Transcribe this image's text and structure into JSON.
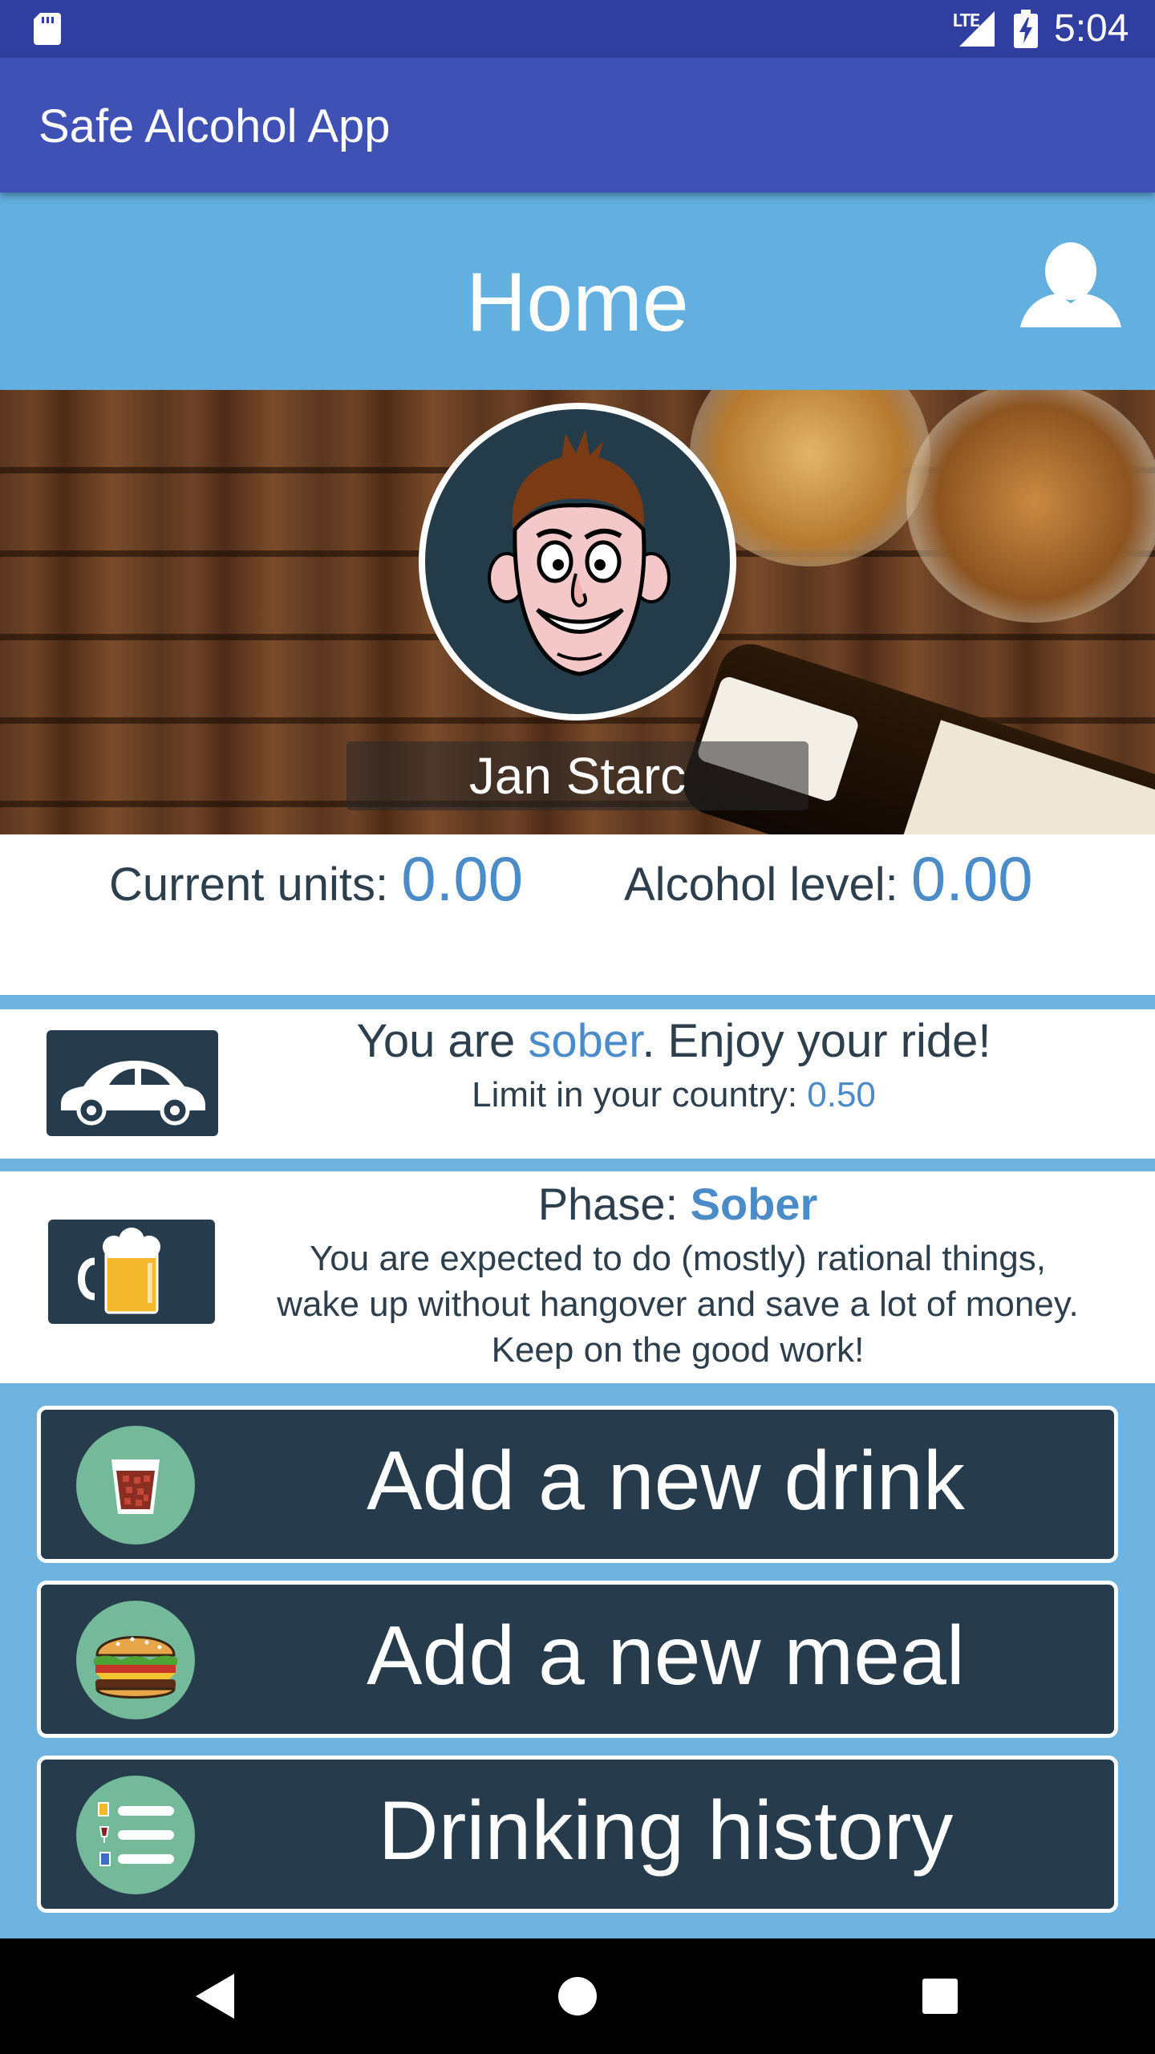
{
  "status_bar": {
    "network": "LTE",
    "time": "5:04",
    "icons": [
      "sd-card-icon",
      "signal-icon",
      "battery-charging-icon"
    ]
  },
  "app_bar": {
    "title": "Safe Alcohol App"
  },
  "header": {
    "title": "Home",
    "profile_icon": "profile-icon"
  },
  "user": {
    "name": "Jan Starc",
    "avatar_icon": "cartoon-face-avatar"
  },
  "stats": {
    "current_units_label": "Current units: ",
    "current_units_value": "0.00",
    "alcohol_level_label": "Alcohol level: ",
    "alcohol_level_value": "0.00"
  },
  "drive": {
    "icon": "car-icon",
    "prefix": "You are ",
    "state": "sober",
    "suffix": ". Enjoy your ride!",
    "limit_label": "Limit in your country: ",
    "limit_value": "0.50"
  },
  "phase": {
    "icon": "beer-mug-icon",
    "label": "Phase: ",
    "name": "Sober",
    "description_lines": [
      "You are expected to do (mostly) rational things,",
      "wake up without hangover and save a lot of money.",
      "Keep on the good work!"
    ]
  },
  "actions": {
    "add_drink": {
      "label": "Add a new drink",
      "icon": "drink-glass-icon"
    },
    "add_meal": {
      "label": "Add a new meal",
      "icon": "burger-icon"
    },
    "history": {
      "label": "Drinking history",
      "icon": "history-list-icon"
    }
  },
  "colors": {
    "status_bar": "#303f9f",
    "app_bar": "#3f51b5",
    "header": "#62afe0",
    "accent": "#4b8bc8",
    "dark_panel": "#263c4c",
    "icon_circle": "#74b99a"
  },
  "nav_bar": {
    "icons": [
      "back-icon",
      "home-icon",
      "recents-icon"
    ]
  }
}
